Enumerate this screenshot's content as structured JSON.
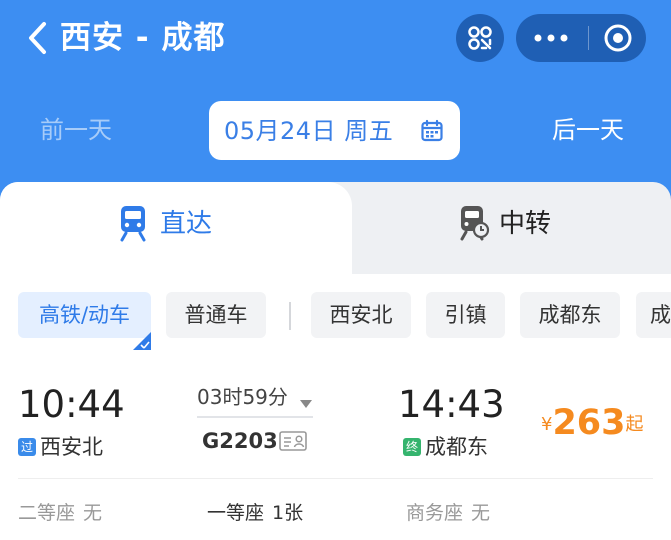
{
  "header": {
    "back_icon": "chevron-left-icon",
    "title": "西安 - 成都",
    "scan_icon": "scan-qr-icon",
    "more_icon": "more-dots-icon",
    "close_icon": "target-circle-icon",
    "colors": {
      "background": "#3d8ef2",
      "capsule": "#1f5fb4"
    }
  },
  "date_bar": {
    "prev_label": "前一天",
    "date_label": "05月24日 周五",
    "calendar_icon": "calendar-icon",
    "next_label": "后一天"
  },
  "tabs": [
    {
      "label": "直达",
      "icon": "train-icon",
      "active": true
    },
    {
      "label": "中转",
      "icon": "train-transfer-icon",
      "active": false
    }
  ],
  "filters": {
    "types": [
      {
        "label": "高铁/动车",
        "active": true
      },
      {
        "label": "普通车",
        "active": false
      }
    ],
    "stations": [
      "西安北",
      "引镇",
      "成都东",
      "成"
    ]
  },
  "trains": [
    {
      "depart_time": "10:44",
      "depart_badge": "过",
      "depart_station": "西安北",
      "duration": "03时59分",
      "train_no": "G2203",
      "arrive_time": "14:43",
      "arrive_badge": "终",
      "arrive_station": "成都东",
      "price_currency": "¥",
      "price_amount": "263",
      "price_suffix": "起",
      "seats": [
        {
          "name": "二等座",
          "count": "无"
        },
        {
          "name": "一等座",
          "count": "1张"
        },
        {
          "name": "商务座",
          "count": "无"
        }
      ]
    }
  ],
  "colors": {
    "accent": "#2f7be8",
    "price": "#f58a1f",
    "badge_pass": "#3a8bea",
    "badge_end": "#35b46e"
  }
}
